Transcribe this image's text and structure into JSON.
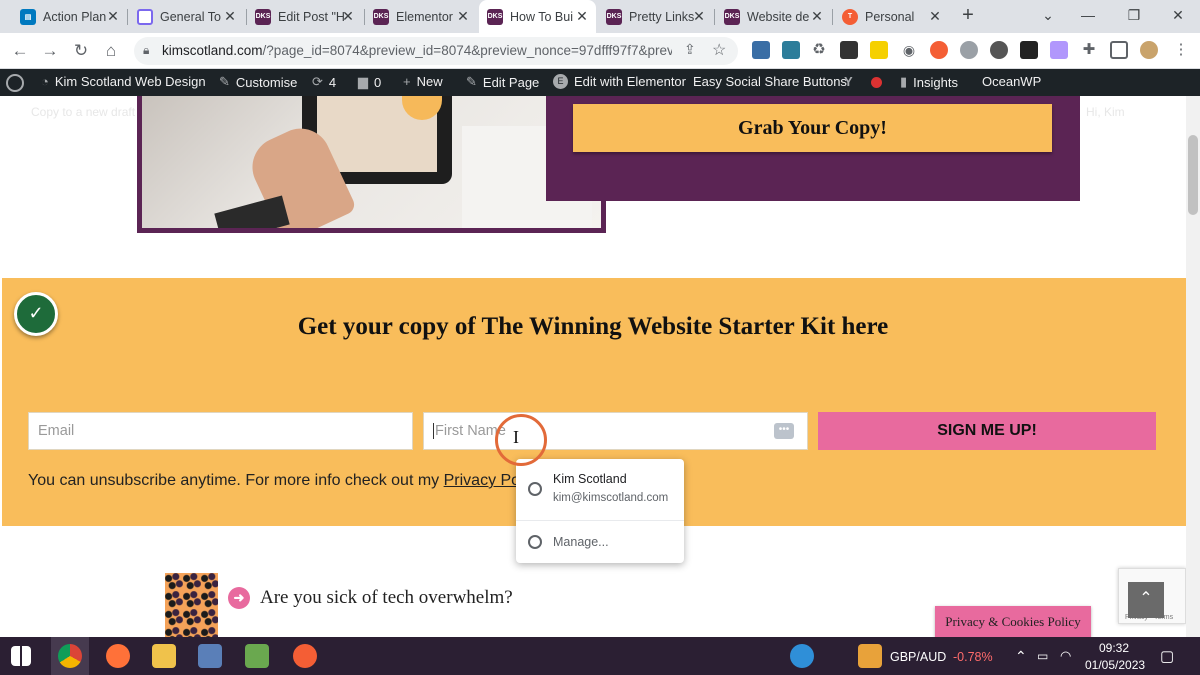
{
  "browser": {
    "tabs": [
      {
        "title": "Action Plan",
        "favicon": "trello-icon",
        "color": "#0079bf",
        "active": false
      },
      {
        "title": "General To",
        "favicon": "clickup-icon",
        "color": "#7b68ee",
        "active": false
      },
      {
        "title": "Edit Post \"H",
        "favicon": "dks-icon",
        "color": "#5b2454",
        "active": false
      },
      {
        "title": "Elementor",
        "favicon": "dks-icon",
        "color": "#5b2454",
        "active": false
      },
      {
        "title": "How To Bui",
        "favicon": "dks-icon",
        "color": "#5b2454",
        "active": true
      },
      {
        "title": "Pretty Links",
        "favicon": "dks-icon",
        "color": "#5b2454",
        "active": false
      },
      {
        "title": "Website de",
        "favicon": "dks-icon",
        "color": "#5b2454",
        "active": false
      },
      {
        "title": "Personal",
        "favicon": "todoist-icon",
        "color": "#f45e35",
        "active": false
      }
    ],
    "new_tab_label": "+",
    "url_host": "kimscotland.com",
    "url_rest": "/?page_id=8074&preview_id=8074&preview_nonce=97dfff97f7&prev..."
  },
  "wp_admin": {
    "site_name": "Kim Scotland Web Design",
    "customise": "Customise",
    "updates": "4",
    "comments": "0",
    "new": "New",
    "edit_page": "Edit Page",
    "edit_elementor": "Edit with Elementor",
    "social_share": "Easy Social Share Buttons",
    "insights": "Insights",
    "theme": "OceanWP"
  },
  "page": {
    "ghost_left": "Copy to a new draft",
    "ghost_right": "Hi, Kim",
    "grab_button": "Grab Your Copy!",
    "heading": "Get your copy of The Winning Website Starter Kit here",
    "email_placeholder": "Email",
    "firstname_placeholder": "First Name",
    "signup_button": "SIGN ME UP!",
    "note_text": "You can unsubscribe anytime. For more info check out my ",
    "note_link": "Privacy Policy",
    "question": "Are you sick of tech overwhelm?",
    "privacy_button": "Privacy & Cookies Policy",
    "recaptcha_text": "Privacy - Terms",
    "accent_color": "#f9bd5b",
    "brand_color": "#5b2454",
    "pink_color": "#e86a9e"
  },
  "autofill": {
    "name": "Kim Scotland",
    "email": "kim@kimscotland.com",
    "manage": "Manage..."
  },
  "taskbar": {
    "currency_pair": "GBP/AUD",
    "currency_change": "-0.78%",
    "time": "09:32",
    "date": "01/05/2023"
  }
}
